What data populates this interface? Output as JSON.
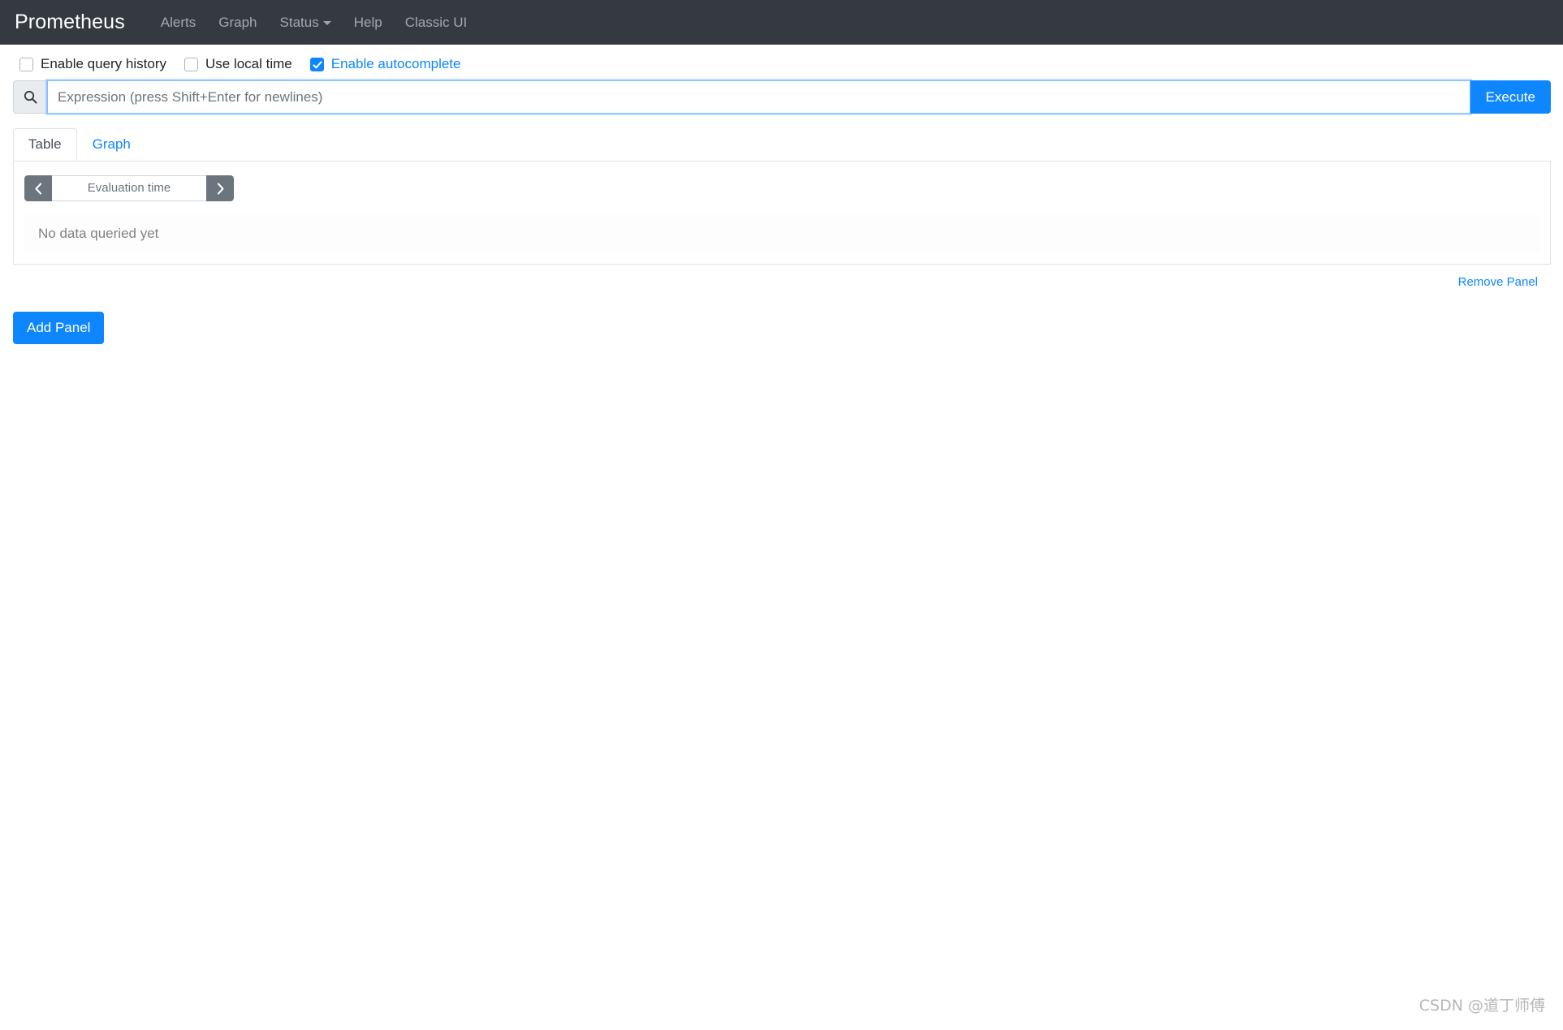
{
  "navbar": {
    "brand": "Prometheus",
    "links": [
      {
        "label": "Alerts",
        "icon": ""
      },
      {
        "label": "Graph",
        "icon": ""
      },
      {
        "label": "Status",
        "icon": "chevron-down-icon"
      },
      {
        "label": "Help",
        "icon": ""
      },
      {
        "label": "Classic UI",
        "icon": ""
      }
    ]
  },
  "options": {
    "query_history": {
      "label": "Enable query history",
      "checked": false
    },
    "local_time": {
      "label": "Use local time",
      "checked": false
    },
    "autocomplete": {
      "label": "Enable autocomplete",
      "checked": true
    }
  },
  "search": {
    "icon": "search-icon",
    "placeholder": "Expression (press Shift+Enter for newlines)",
    "value": "",
    "execute_label": "Execute"
  },
  "tabs": [
    {
      "label": "Table",
      "active": true
    },
    {
      "label": "Graph",
      "active": false
    }
  ],
  "evaluation": {
    "prev_icon": "chevron-left-icon",
    "next_icon": "chevron-right-icon",
    "placeholder": "Evaluation time",
    "value": ""
  },
  "result": {
    "empty_message": "No data queried yet"
  },
  "panel_actions": {
    "remove_label": "Remove Panel",
    "add_label": "Add Panel"
  },
  "watermark": {
    "text": "CSDN @道丁师傅"
  },
  "colors": {
    "navbar_bg": "#343a40",
    "accent": "#0d86ff",
    "muted_text": "#6c757d",
    "border": "#dee2e6"
  }
}
